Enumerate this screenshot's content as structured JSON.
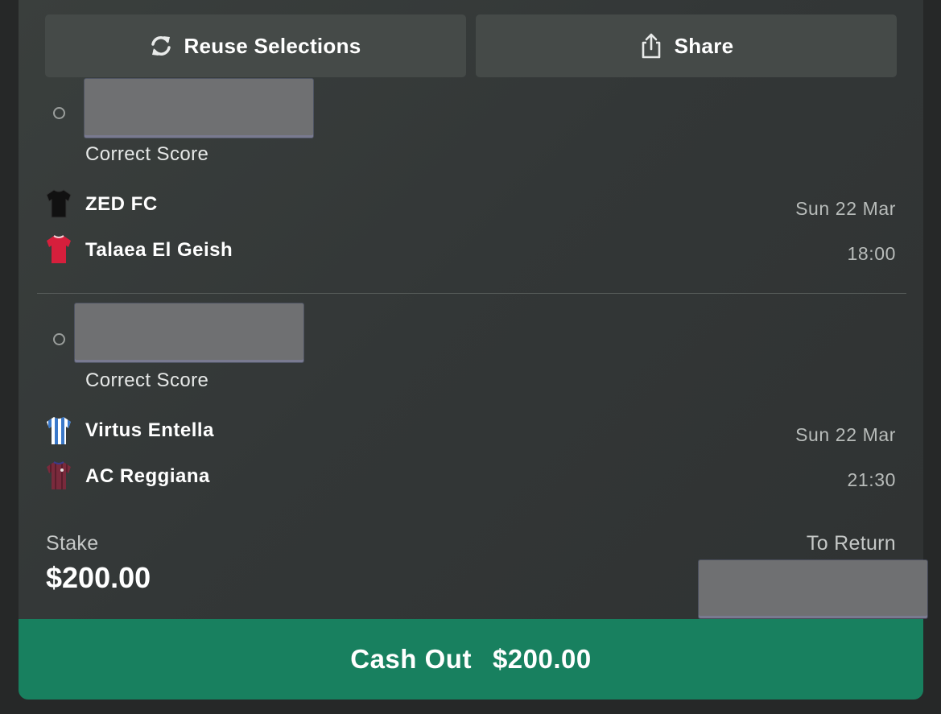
{
  "actions": {
    "reuse_label": "Reuse Selections",
    "share_label": "Share"
  },
  "selections": [
    {
      "market": "Correct Score",
      "home_team": "ZED FC",
      "away_team": "Talaea El Geish",
      "date": "Sun 22 Mar",
      "time": "18:00",
      "home_kit_color": "#111111",
      "away_kit_color": "#d61f3c"
    },
    {
      "market": "Correct Score",
      "home_team": "Virtus Entella",
      "away_team": "AC Reggiana",
      "date": "Sun 22 Mar",
      "time": "21:30",
      "home_kit_color": "#3a78c9",
      "away_kit_color": "#7a2a3c"
    }
  ],
  "summary": {
    "stake_label": "Stake",
    "stake_value": "$200.00",
    "return_label": "To Return"
  },
  "cashout": {
    "label": "Cash Out",
    "amount": "$200.00",
    "color": "#18805f"
  }
}
